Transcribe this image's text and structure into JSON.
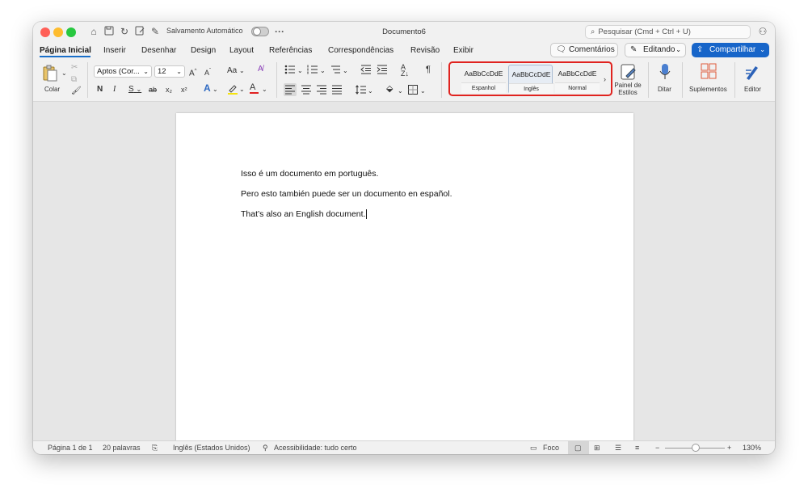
{
  "window": {
    "title": "Documento6",
    "autosave_label": "Salvamento Automático",
    "search_placeholder": "Pesquisar (Cmd + Ctrl + U)"
  },
  "tabs": [
    {
      "label": "Página Inicial",
      "active": true
    },
    {
      "label": "Inserir"
    },
    {
      "label": "Desenhar"
    },
    {
      "label": "Design"
    },
    {
      "label": "Layout"
    },
    {
      "label": "Referências"
    },
    {
      "label": "Correspondências"
    },
    {
      "label": "Revisão"
    },
    {
      "label": "Exibir"
    }
  ],
  "header_buttons": {
    "comments": "Comentários",
    "editing": "Editando",
    "share": "Compartilhar"
  },
  "ribbon": {
    "paste_label": "Colar",
    "font_name": "Aptos (Cor...",
    "font_size": "12",
    "grow_font": "A^",
    "shrink_font": "Aˇ",
    "change_case": "Aa",
    "bold": "N",
    "italic": "I",
    "underline": "S",
    "strikethrough": "ab",
    "subscript": "x₂",
    "superscript": "x²",
    "styles": [
      {
        "sample": "AaBbCcDdE",
        "name": "Espanhol"
      },
      {
        "sample": "AaBbCcDdE",
        "name": "Inglês",
        "active": true
      },
      {
        "sample": "AaBbCcDdE",
        "name": "Normal"
      }
    ],
    "styles_pane": "Painel de Estilos",
    "dictate": "Ditar",
    "addins": "Suplementos",
    "editor": "Editor"
  },
  "document": {
    "paragraphs": [
      "Isso é um documento em português.",
      "Pero esto también puede ser un documento en español.",
      "That’s also an English document."
    ]
  },
  "status_bar": {
    "page": "Página 1 de 1",
    "words": "20 palavras",
    "language": "Inglês (Estados Unidos)",
    "accessibility": "Acessibilidade: tudo certo",
    "focus": "Foco",
    "zoom": "130%"
  },
  "colors": {
    "accent": "#1765c9",
    "highlight_box": "#e0231f",
    "close": "#ff5f57",
    "minimize": "#febc2e",
    "zoom": "#28c840"
  }
}
